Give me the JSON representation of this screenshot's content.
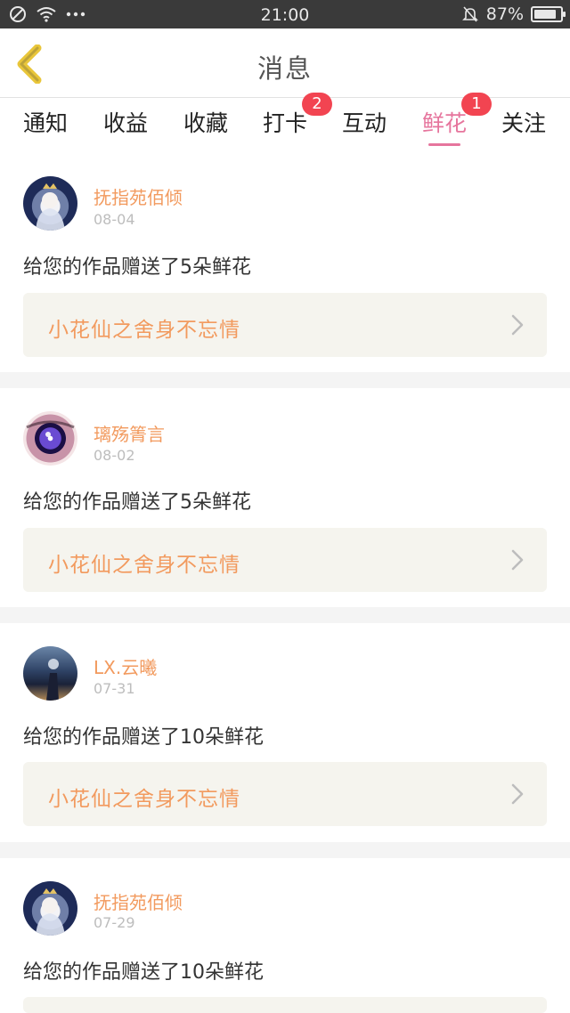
{
  "status_bar": {
    "time": "21:00",
    "battery": "87%",
    "battery_level": 0.87,
    "icons": [
      "no-sim-icon",
      "wifi-icon",
      "more-dots-icon",
      "bell-off-icon",
      "battery-icon"
    ]
  },
  "header": {
    "title": "消息",
    "back_icon": "chevron-left-icon"
  },
  "tabs": [
    {
      "label": "通知",
      "badge": ""
    },
    {
      "label": "收益",
      "badge": ""
    },
    {
      "label": "收藏",
      "badge": ""
    },
    {
      "label": "打卡",
      "badge": "2"
    },
    {
      "label": "互动",
      "badge": ""
    },
    {
      "label": "鲜花",
      "badge": "1",
      "active": true
    },
    {
      "label": "关注",
      "badge": ""
    }
  ],
  "colors": {
    "accent": "#e6759d",
    "name_orange": "#f29a5e",
    "badge_red": "#f24451",
    "card_bg": "#f5f4ee"
  },
  "messages": [
    {
      "user": "抚指苑佰倾",
      "date": "08-04",
      "text": "给您的作品赠送了5朵鲜花",
      "work": "小花仙之舍身不忘情"
    },
    {
      "user": "璃殇箐言",
      "date": "08-02",
      "text": "给您的作品赠送了5朵鲜花",
      "work": "小花仙之舍身不忘情"
    },
    {
      "user": "LX.云曦",
      "date": "07-31",
      "text": "给您的作品赠送了10朵鲜花",
      "work": "小花仙之舍身不忘情"
    },
    {
      "user": "抚指苑佰倾",
      "date": "07-29",
      "text": "给您的作品赠送了10朵鲜花",
      "work": ""
    }
  ]
}
